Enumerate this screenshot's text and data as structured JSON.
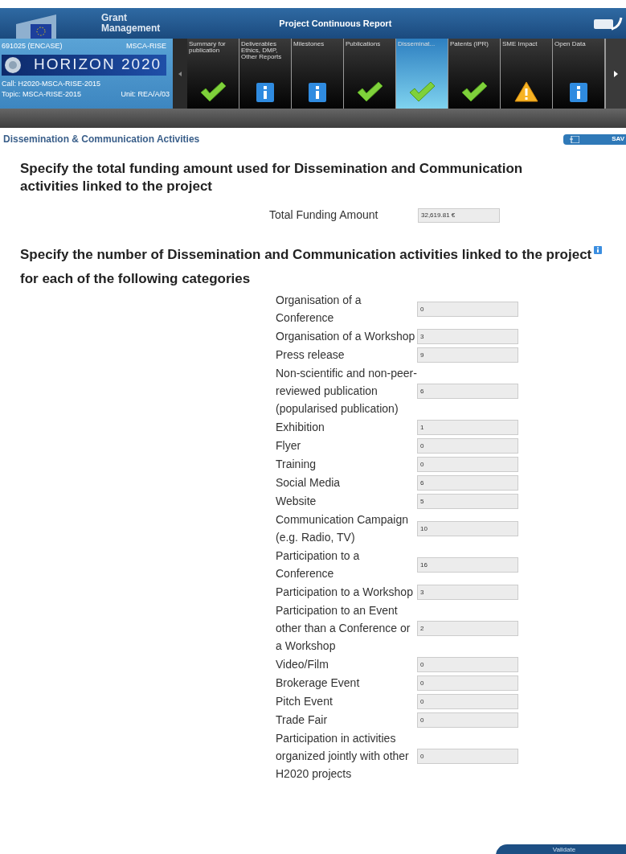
{
  "header": {
    "brand": "Grant\nManagement",
    "title": "Project Continuous Report"
  },
  "project": {
    "id": "691025 (ENCASE)",
    "type": "MSCA-RISE",
    "programme": "HORIZON 2020",
    "call": "Call: H2020-MSCA-RISE-2015",
    "topic": "Topic: MSCA-RISE-2015",
    "unit": "Unit: REA/A/03"
  },
  "tabs": [
    {
      "label": "Summary for publication",
      "kind": "check",
      "selected": false
    },
    {
      "label": "Deliverables Ethics, DMP, Other Reports",
      "kind": "info",
      "selected": false
    },
    {
      "label": "Milestones",
      "kind": "info",
      "selected": false
    },
    {
      "label": "Publications",
      "kind": "check",
      "selected": false
    },
    {
      "label": "Disseminat...",
      "kind": "check",
      "selected": true
    },
    {
      "label": "Patents (IPR)",
      "kind": "check",
      "selected": false
    },
    {
      "label": "SME Impact",
      "kind": "warning",
      "selected": false
    },
    {
      "label": "Open Data",
      "kind": "info",
      "selected": false
    }
  ],
  "page_title": "Dissemination & Communication Activities",
  "save_button": "SAV",
  "funding": {
    "heading": "Specify the total funding amount used for Dissemination and Communication activities linked to the project",
    "label": "Total Funding Amount",
    "value": "32,619.81 €"
  },
  "activities": {
    "heading": "Specify the number of Dissemination and Communication activities linked to the project for each of the following categories",
    "rows": [
      {
        "label": "Organisation of a Conference",
        "value": "0"
      },
      {
        "label": "Organisation of a Workshop",
        "value": "3"
      },
      {
        "label": "Press release",
        "value": "9"
      },
      {
        "label": "Non-scientific and non-peer-reviewed publication (popularised publication)",
        "value": "6"
      },
      {
        "label": "Exhibition",
        "value": "1"
      },
      {
        "label": "Flyer",
        "value": "0"
      },
      {
        "label": "Training",
        "value": "0"
      },
      {
        "label": "Social Media",
        "value": "6"
      },
      {
        "label": "Website",
        "value": "5"
      },
      {
        "label": "Communication Campaign (e.g. Radio, TV)",
        "value": "10"
      },
      {
        "label": "Participation to a Conference",
        "value": "16"
      },
      {
        "label": "Participation to a Workshop",
        "value": "3"
      },
      {
        "label": "Participation to an Event other than a Conference or a Workshop",
        "value": "2"
      },
      {
        "label": "Video/Film",
        "value": "0"
      },
      {
        "label": "Brokerage Event",
        "value": "0"
      },
      {
        "label": "Pitch Event",
        "value": "0"
      },
      {
        "label": "Trade Fair",
        "value": "0"
      },
      {
        "label": "Participation in activities organized jointly with other H2020 projects",
        "value": "0"
      }
    ]
  },
  "validate_button": "Validate"
}
